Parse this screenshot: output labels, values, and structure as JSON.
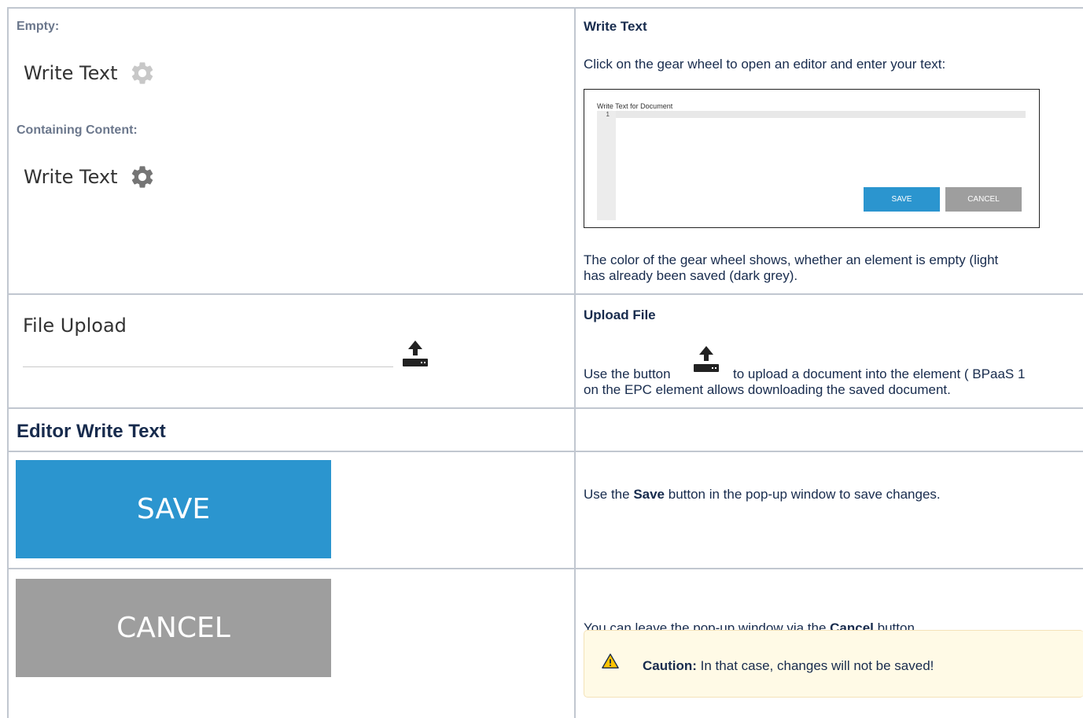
{
  "empty_section": {
    "label": "Empty:",
    "write_text_label": "Write Text",
    "containing_label": "Containing Content:",
    "write_text_label2": "Write Text",
    "gear_light_color": "#c8c8c8",
    "gear_dark_color": "#757575"
  },
  "write_text_desc": {
    "heading": "Write Text",
    "intro": "Click on the gear wheel to open an editor and enter your text:",
    "editor_title": "Write Text for Document",
    "editor_line_number": "1",
    "editor_save": "SAVE",
    "editor_cancel": "CANCEL",
    "color_line1": "The color of the gear wheel shows, whether an element is empty (light",
    "color_line2": "has already been saved (dark grey)."
  },
  "file_upload": {
    "label": "File Upload",
    "icon": "upload-icon",
    "heading": "Upload File",
    "desc_part1": "Use the button",
    "desc_part2": "to upload a document into the element ( BPaaS 1",
    "desc_line2": "on the EPC element allows downloading the saved document."
  },
  "editor_section": {
    "heading": "Editor Write Text"
  },
  "save_row": {
    "button_label": "SAVE",
    "button_color": "#2b95cf",
    "desc_pre": "Use the ",
    "desc_bold": "Save",
    "desc_post": " button in the pop-up window to save changes."
  },
  "cancel_row": {
    "button_label": "CANCEL",
    "button_color": "#9e9e9e",
    "desc_pre": "You can leave the pop-up window via the ",
    "desc_bold": "Cancel",
    "desc_post": " button.",
    "caution_bold": "Caution:",
    "caution_text": " In that case, changes will not be saved!",
    "caution_icon": "warning-icon"
  }
}
